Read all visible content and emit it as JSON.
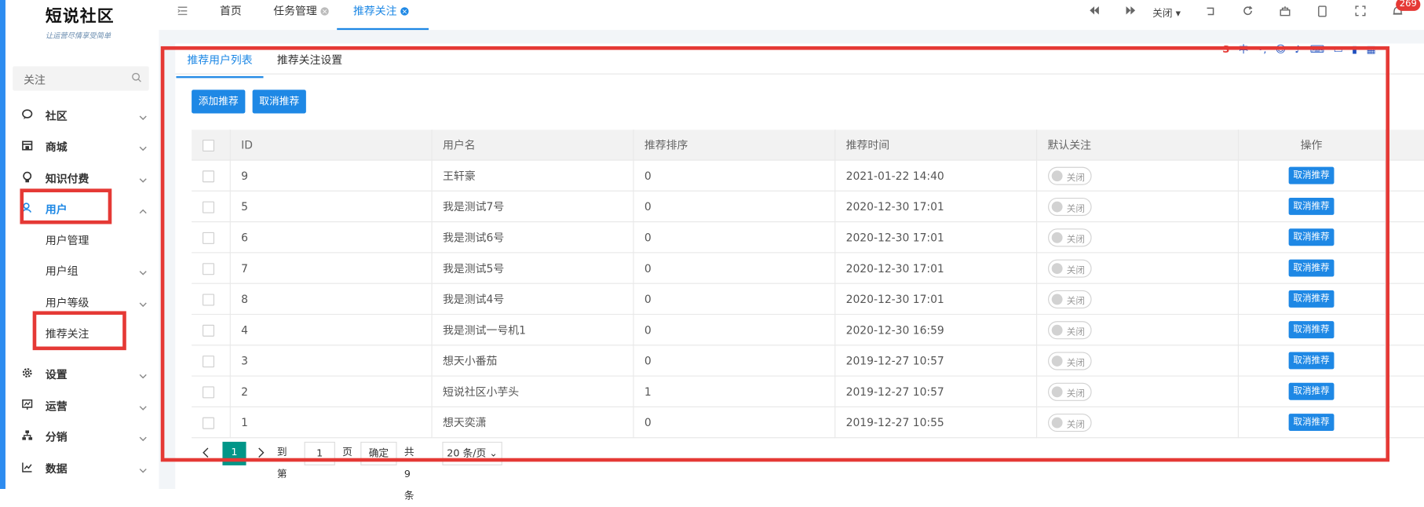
{
  "app": {
    "logo_title": "短说社区",
    "logo_slogan": "让运营尽情享受简单"
  },
  "sidebar": {
    "search_text": "关注",
    "items": [
      {
        "label": "社区",
        "icon": "chat-icon"
      },
      {
        "label": "商城",
        "icon": "shop-icon"
      },
      {
        "label": "知识付费",
        "icon": "bulb-icon"
      },
      {
        "label": "用户",
        "icon": "user-icon"
      },
      {
        "label": "设置",
        "icon": "gear-icon"
      },
      {
        "label": "运营",
        "icon": "chart-icon"
      },
      {
        "label": "分销",
        "icon": "sitemap-icon"
      },
      {
        "label": "数据",
        "icon": "line-chart-icon"
      }
    ],
    "sub_items": [
      "用户管理",
      "用户组",
      "用户等级",
      "推荐关注"
    ]
  },
  "topbar": {
    "tabs": [
      {
        "label": "首页"
      },
      {
        "label": "任务管理"
      },
      {
        "label": "推荐关注"
      }
    ],
    "close_label": "关闭",
    "badge_count": "269"
  },
  "content": {
    "tabs": [
      "推荐用户列表",
      "推荐关注设置"
    ],
    "buttons": {
      "add": "添加推荐",
      "cancel": "取消推荐"
    },
    "table": {
      "headers": [
        "ID",
        "用户名",
        "推荐排序",
        "推荐时间",
        "默认关注",
        "操作"
      ],
      "rows": [
        {
          "id": "9",
          "name": "王轩豪",
          "order": "0",
          "time": "2021-01-22 14:40",
          "follow": "关闭",
          "action": "取消推荐"
        },
        {
          "id": "5",
          "name": "我是测试7号",
          "order": "0",
          "time": "2020-12-30 17:01",
          "follow": "关闭",
          "action": "取消推荐"
        },
        {
          "id": "6",
          "name": "我是测试6号",
          "order": "0",
          "time": "2020-12-30 17:01",
          "follow": "关闭",
          "action": "取消推荐"
        },
        {
          "id": "7",
          "name": "我是测试5号",
          "order": "0",
          "time": "2020-12-30 17:01",
          "follow": "关闭",
          "action": "取消推荐"
        },
        {
          "id": "8",
          "name": "我是测试4号",
          "order": "0",
          "time": "2020-12-30 17:01",
          "follow": "关闭",
          "action": "取消推荐"
        },
        {
          "id": "4",
          "name": "我是测试一号机1",
          "order": "0",
          "time": "2020-12-30 16:59",
          "follow": "关闭",
          "action": "取消推荐"
        },
        {
          "id": "3",
          "name": "想天小番茄",
          "order": "0",
          "time": "2019-12-27 10:57",
          "follow": "关闭",
          "action": "取消推荐"
        },
        {
          "id": "2",
          "name": "短说社区小芋头",
          "order": "1",
          "time": "2019-12-27 10:57",
          "follow": "关闭",
          "action": "取消推荐"
        },
        {
          "id": "1",
          "name": "想天奕潇",
          "order": "0",
          "time": "2019-12-27 10:55",
          "follow": "关闭",
          "action": "取消推荐"
        }
      ]
    },
    "pager": {
      "current": "1",
      "goto_label": "到第",
      "page_value": "1",
      "page_unit": "页",
      "confirm": "确定",
      "total": "共 9 条",
      "page_size": "20 条/页"
    }
  },
  "ime": {
    "lang": "中"
  },
  "colors": {
    "accent": "#1e88e5",
    "highlight": "#e53935",
    "page_green": "#009688"
  }
}
